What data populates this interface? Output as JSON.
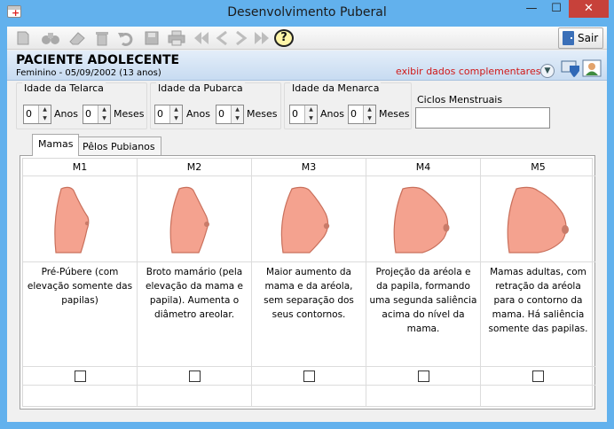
{
  "window": {
    "title": "Desenvolvimento Puberal",
    "minimize": "—",
    "maximize": "☐",
    "close": "✕"
  },
  "toolbar": {
    "exit_label": "Sair",
    "help_label": "?"
  },
  "patient": {
    "name": "PACIENTE ADOLECENTE",
    "info": "Feminino - 05/09/2002 (13 anos)",
    "complement_link": "exibir dados complementares..."
  },
  "ages": {
    "telarca": {
      "label": "Idade da Telarca",
      "years": "0",
      "months": "0"
    },
    "pubarca": {
      "label": "Idade da Pubarca",
      "years": "0",
      "months": "0"
    },
    "menarca": {
      "label": "Idade da Menarca",
      "years": "0",
      "months": "0"
    },
    "years_unit": "Anos",
    "months_unit": "Meses",
    "cycles_label": "Ciclos Menstruais",
    "cycles_value": ""
  },
  "tabs": [
    {
      "label": "Mamas"
    },
    {
      "label": "Pêlos Pubianos"
    }
  ],
  "stages": [
    {
      "code": "M1",
      "desc": "Pré-Púbere (com elevação somente das papilas)"
    },
    {
      "code": "M2",
      "desc": "Broto mamário (pela elevação da mama e papila). Aumenta o diâmetro areolar."
    },
    {
      "code": "M3",
      "desc": "Maior aumento da mama e da aréola, sem separação dos seus contornos."
    },
    {
      "code": "M4",
      "desc": "Projeção da aréola e da papila, formando uma segunda saliência acima do nível da mama."
    },
    {
      "code": "M5",
      "desc": "Mamas adultas, com retração da aréola para o contorno da mama. Há saliência somente das papilas."
    }
  ],
  "colors": {
    "titlebar": "#62b1ed",
    "link": "#d01919",
    "skin": "#f4a28f",
    "close": "#c7413a"
  }
}
